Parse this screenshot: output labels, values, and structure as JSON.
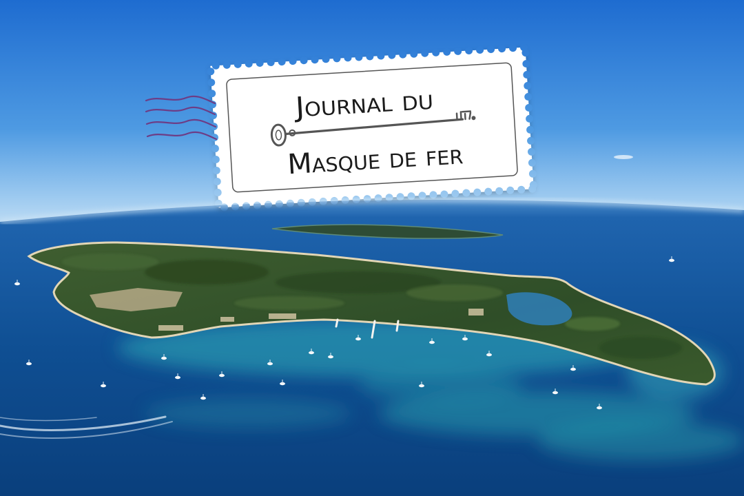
{
  "stamp": {
    "line1": "Journal du",
    "line2": "Masque de fer"
  },
  "icons": {
    "key": "key-icon",
    "postmark": "postmark-wave-lines"
  },
  "colors": {
    "sky_top": "#1e6cd0",
    "sky_horizon": "#c9e2f5",
    "sea_deep": "#0c4585",
    "shallows": "#2fa7b5",
    "island": "#34532b",
    "stamp_paper": "#ffffff",
    "stamp_ink": "#555555",
    "postmark": "#6d3d86"
  }
}
